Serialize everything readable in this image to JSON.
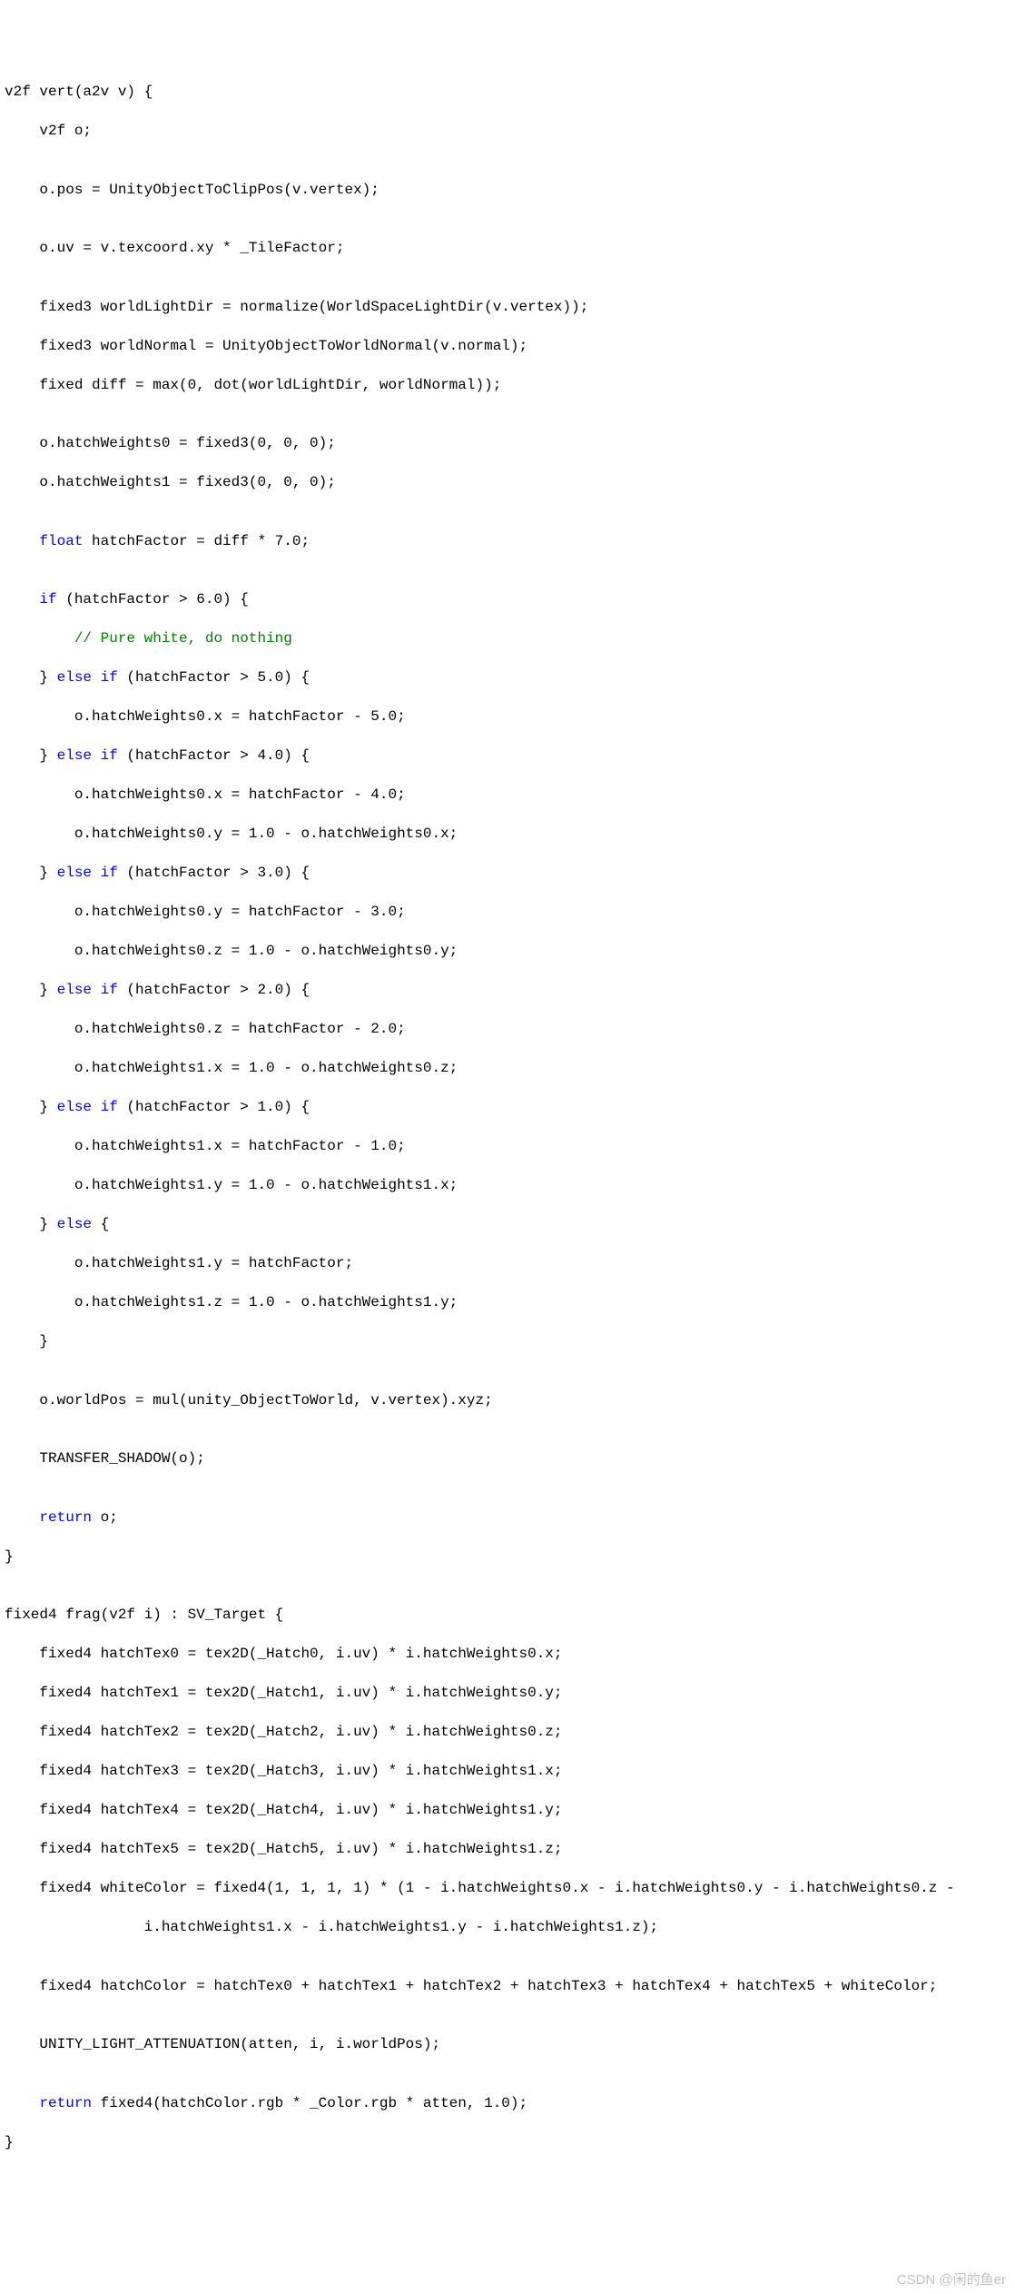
{
  "code": {
    "l01a": "v2f vert(a2v v) {",
    "l02a": "    v2f o;",
    "l03a": "",
    "l04a": "    o.pos = UnityObjectToClipPos(v.vertex);",
    "l05a": "",
    "l06a": "    o.uv = v.texcoord.xy * _TileFactor;",
    "l07a": "",
    "l08a": "    fixed3 worldLightDir = normalize(WorldSpaceLightDir(v.vertex));",
    "l09a": "    fixed3 worldNormal = UnityObjectToWorldNormal(v.normal);",
    "l10a": "    fixed diff = max(0, dot(worldLightDir, worldNormal));",
    "l11a": "",
    "l12a": "    o.hatchWeights0 = fixed3(0, 0, 0);",
    "l13a": "    o.hatchWeights1 = fixed3(0, 0, 0);",
    "l14a": "",
    "l15b": "float",
    "l15c": " hatchFactor = diff * 7.0;",
    "l16a": "",
    "l17b": "if",
    "l17c": " (hatchFactor > 6.0) {",
    "l18b": "// Pure white, do nothing",
    "l19a": "    } ",
    "l19b": "else",
    "l19c": " ",
    "l19d": "if",
    "l19e": " (hatchFactor > 5.0) {",
    "l20a": "        o.hatchWeights0.x = hatchFactor - 5.0;",
    "l21a": "    } ",
    "l21b": "else",
    "l21c": " ",
    "l21d": "if",
    "l21e": " (hatchFactor > 4.0) {",
    "l22a": "        o.hatchWeights0.x = hatchFactor - 4.0;",
    "l23a": "        o.hatchWeights0.y = 1.0 - o.hatchWeights0.x;",
    "l24a": "    } ",
    "l24b": "else",
    "l24c": " ",
    "l24d": "if",
    "l24e": " (hatchFactor > 3.0) {",
    "l25a": "        o.hatchWeights0.y = hatchFactor - 3.0;",
    "l26a": "        o.hatchWeights0.z = 1.0 - o.hatchWeights0.y;",
    "l27a": "    } ",
    "l27b": "else",
    "l27c": " ",
    "l27d": "if",
    "l27e": " (hatchFactor > 2.0) {",
    "l28a": "        o.hatchWeights0.z = hatchFactor - 2.0;",
    "l29a": "        o.hatchWeights1.x = 1.0 - o.hatchWeights0.z;",
    "l30a": "    } ",
    "l30b": "else",
    "l30c": " ",
    "l30d": "if",
    "l30e": " (hatchFactor > 1.0) {",
    "l31a": "        o.hatchWeights1.x = hatchFactor - 1.0;",
    "l32a": "        o.hatchWeights1.y = 1.0 - o.hatchWeights1.x;",
    "l33a": "    } ",
    "l33b": "else",
    "l33c": " {",
    "l34a": "        o.hatchWeights1.y = hatchFactor;",
    "l35a": "        o.hatchWeights1.z = 1.0 - o.hatchWeights1.y;",
    "l36a": "    }",
    "l37a": "",
    "l38a": "    o.worldPos = mul(unity_ObjectToWorld, v.vertex).xyz;",
    "l39a": "",
    "l40a": "    TRANSFER_SHADOW(o);",
    "l41a": "",
    "l42b": "return",
    "l42c": " o;",
    "l43a": "}",
    "l44a": "",
    "l45a": "fixed4 frag(v2f i) : SV_Target {",
    "l46a": "    fixed4 hatchTex0 = tex2D(_Hatch0, i.uv) * i.hatchWeights0.x;",
    "l47a": "    fixed4 hatchTex1 = tex2D(_Hatch1, i.uv) * i.hatchWeights0.y;",
    "l48a": "    fixed4 hatchTex2 = tex2D(_Hatch2, i.uv) * i.hatchWeights0.z;",
    "l49a": "    fixed4 hatchTex3 = tex2D(_Hatch3, i.uv) * i.hatchWeights1.x;",
    "l50a": "    fixed4 hatchTex4 = tex2D(_Hatch4, i.uv) * i.hatchWeights1.y;",
    "l51a": "    fixed4 hatchTex5 = tex2D(_Hatch5, i.uv) * i.hatchWeights1.z;",
    "l52a": "    fixed4 whiteColor = fixed4(1, 1, 1, 1) * (1 - i.hatchWeights0.x - i.hatchWeights0.y - i.hatchWeights0.z - ",
    "l53a": "                i.hatchWeights1.x - i.hatchWeights1.y - i.hatchWeights1.z);",
    "l54a": "",
    "l55a": "    fixed4 hatchColor = hatchTex0 + hatchTex1 + hatchTex2 + hatchTex3 + hatchTex4 + hatchTex5 + whiteColor;",
    "l56a": "",
    "l57a": "    UNITY_LIGHT_ATTENUATION(atten, i, i.worldPos);",
    "l58a": "",
    "l59b": "return",
    "l59c": " fixed4(hatchColor.rgb * _Color.rgb * atten, 1.0);",
    "l60a": "}"
  },
  "watermark": "CSDN @闲的鱼er"
}
